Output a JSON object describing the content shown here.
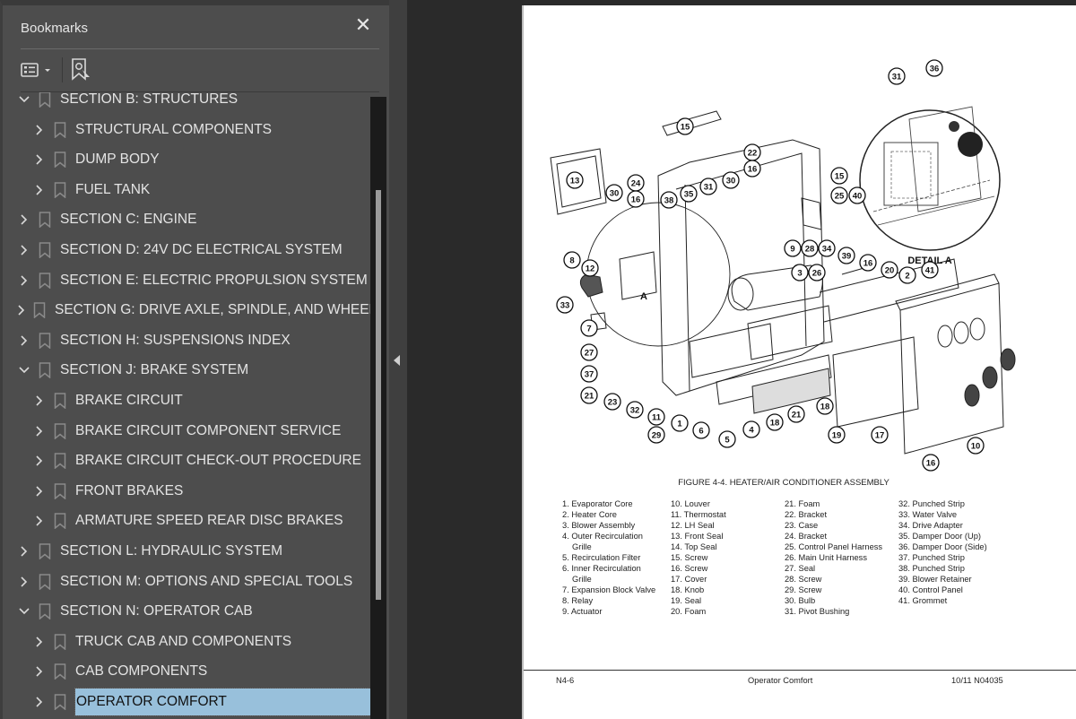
{
  "bookmarks_panel": {
    "title": "Bookmarks",
    "close_icon": "close-icon",
    "toolbar": {
      "options_icon": "list-options-icon",
      "find_current_icon": "find-current-bookmark-icon"
    },
    "items": [
      {
        "level": 0,
        "expanded": true,
        "label": "SECTION B: STRUCTURES"
      },
      {
        "level": 1,
        "expanded": false,
        "label": "STRUCTURAL COMPONENTS"
      },
      {
        "level": 1,
        "expanded": false,
        "label": "DUMP BODY"
      },
      {
        "level": 1,
        "expanded": false,
        "label": "FUEL TANK"
      },
      {
        "level": 0,
        "expanded": false,
        "label": "SECTION C: ENGINE"
      },
      {
        "level": 0,
        "expanded": false,
        "label": "SECTION D: 24V DC ELECTRICAL SYSTEM"
      },
      {
        "level": 0,
        "expanded": false,
        "label": "SECTION E: ELECTRIC PROPULSION SYSTEM"
      },
      {
        "level": 0,
        "expanded": false,
        "label": "SECTION G: DRIVE AXLE, SPINDLE, AND WHEELS"
      },
      {
        "level": 0,
        "expanded": false,
        "label": "SECTION H:  SUSPENSIONS INDEX"
      },
      {
        "level": 0,
        "expanded": true,
        "label": "SECTION J: BRAKE SYSTEM"
      },
      {
        "level": 1,
        "expanded": false,
        "label": "BRAKE CIRCUIT"
      },
      {
        "level": 1,
        "expanded": false,
        "label": "BRAKE CIRCUIT COMPONENT SERVICE"
      },
      {
        "level": 1,
        "expanded": false,
        "label": "BRAKE CIRCUIT CHECK-OUT PROCEDURE"
      },
      {
        "level": 1,
        "expanded": false,
        "label": "FRONT BRAKES"
      },
      {
        "level": 1,
        "expanded": false,
        "label": "ARMATURE SPEED REAR DISC BRAKES"
      },
      {
        "level": 0,
        "expanded": false,
        "label": "SECTION L:  HYDRAULIC SYSTEM"
      },
      {
        "level": 0,
        "expanded": false,
        "label": "SECTION M: OPTIONS AND SPECIAL TOOLS"
      },
      {
        "level": 0,
        "expanded": true,
        "label": "SECTION N: OPERATOR CAB"
      },
      {
        "level": 1,
        "expanded": false,
        "label": "TRUCK CAB AND COMPONENTS"
      },
      {
        "level": 1,
        "expanded": false,
        "label": "CAB COMPONENTS"
      },
      {
        "level": 1,
        "expanded": false,
        "label": "OPERATOR COMFORT",
        "selected": true
      }
    ],
    "selection_color": "#98c0db"
  },
  "document": {
    "detail_label": "DETAIL A",
    "view_marker": "A",
    "figure_caption": "FIGURE 4-4. HEATER/AIR CONDITIONER ASSEMBLY",
    "legend_columns": [
      [
        "1. Evaporator Core",
        "2. Heater Core",
        "3. Blower Assembly",
        "4. Outer Recirculation",
        "Grille",
        "5. Recirculation Filter",
        "6. Inner Recirculation",
        "Grille",
        "7. Expansion Block Valve",
        "8. Relay",
        "9. Actuator"
      ],
      [
        "10. Louver",
        "11. Thermostat",
        "12. LH Seal",
        "13. Front Seal",
        "14. Top Seal",
        "15. Screw",
        "16. Screw",
        "17. Cover",
        "18. Knob",
        "19. Seal",
        "20. Foam"
      ],
      [
        "21. Foam",
        "22. Bracket",
        "23. Case",
        "24. Bracket",
        "25. Control Panel Harness",
        "26. Main Unit Harness",
        "27. Seal",
        "28. Screw",
        "29. Screw",
        "30. Bulb",
        "31. Pivot Bushing"
      ],
      [
        "32. Punched Strip",
        "33. Water Valve",
        "34. Drive Adapter",
        "35. Damper Door (Up)",
        "36. Damper Door (Side)",
        "37. Punched Strip",
        "38. Punched Strip",
        "39. Blower Retainer",
        "40. Control Panel",
        "41. Grommet"
      ]
    ],
    "callouts": [
      "31",
      "36",
      "15",
      "22",
      "16",
      "13",
      "24",
      "16",
      "30",
      "38",
      "35",
      "31",
      "30",
      "15",
      "25",
      "40",
      "9",
      "28",
      "34",
      "8",
      "12",
      "3",
      "26",
      "39",
      "16",
      "20",
      "2",
      "41",
      "33",
      "7",
      "27",
      "37",
      "21",
      "23",
      "32",
      "11",
      "29",
      "1",
      "6",
      "5",
      "4",
      "18",
      "21",
      "18",
      "19",
      "17",
      "16",
      "10"
    ],
    "footer": {
      "left": "N4-6",
      "center": "Operator Comfort",
      "right": "10/11  N04035"
    }
  }
}
